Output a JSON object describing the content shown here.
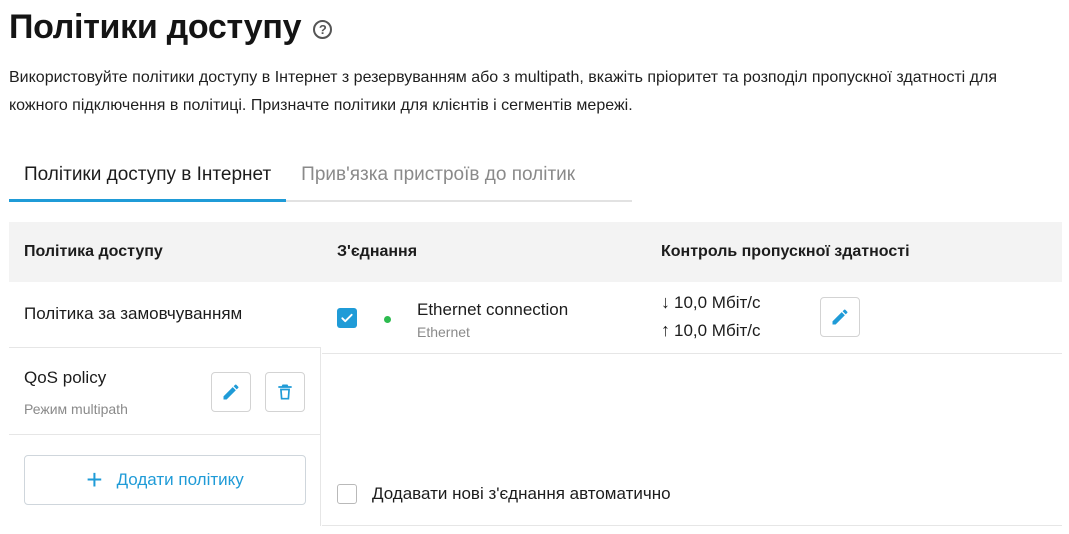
{
  "header": {
    "title": "Політики доступу",
    "help_icon": "?",
    "description": "Використовуйте політики доступу в Інтернет з резервуванням або з multipath, вкажіть пріоритет та розподіл пропускної здатності для кожного підключення в політиці. Призначте політики для клієнтів і сегментів мережі."
  },
  "tabs": [
    {
      "label": "Політики доступу в Інтернет",
      "active": true
    },
    {
      "label": "Прив'язка пристроїв до політик",
      "active": false
    }
  ],
  "table": {
    "headers": {
      "policy": "Політика доступу",
      "connection": "З'єднання",
      "bandwidth": "Контроль пропускної здатності"
    },
    "policies": [
      {
        "name": "Політика за замовчуванням",
        "mode": ""
      },
      {
        "name": "QoS policy",
        "mode": "Режим multipath"
      }
    ],
    "add_policy_label": "Додати політику",
    "add_policy_icon": "+",
    "connections": [
      {
        "name": "Ethernet connection",
        "type": "Ethernet",
        "checked": true,
        "status_color": "#2dbb4f",
        "download": "10,0 Мбіт/с",
        "upload": "10,0 Мбіт/с",
        "download_arrow": "↓",
        "upload_arrow": "↑"
      }
    ],
    "auto_add_label": "Додавати нові з'єднання автоматично",
    "auto_add_checked": false
  },
  "colors": {
    "accent": "#1f9bd7",
    "status_online": "#2dbb4f",
    "header_bg": "#f3f3f3",
    "muted_text": "#8a8a8a"
  },
  "icons": {
    "help": "help-circle-icon",
    "edit": "pencil-icon",
    "delete": "trash-icon",
    "add": "plus-icon",
    "check": "checkmark-icon"
  }
}
